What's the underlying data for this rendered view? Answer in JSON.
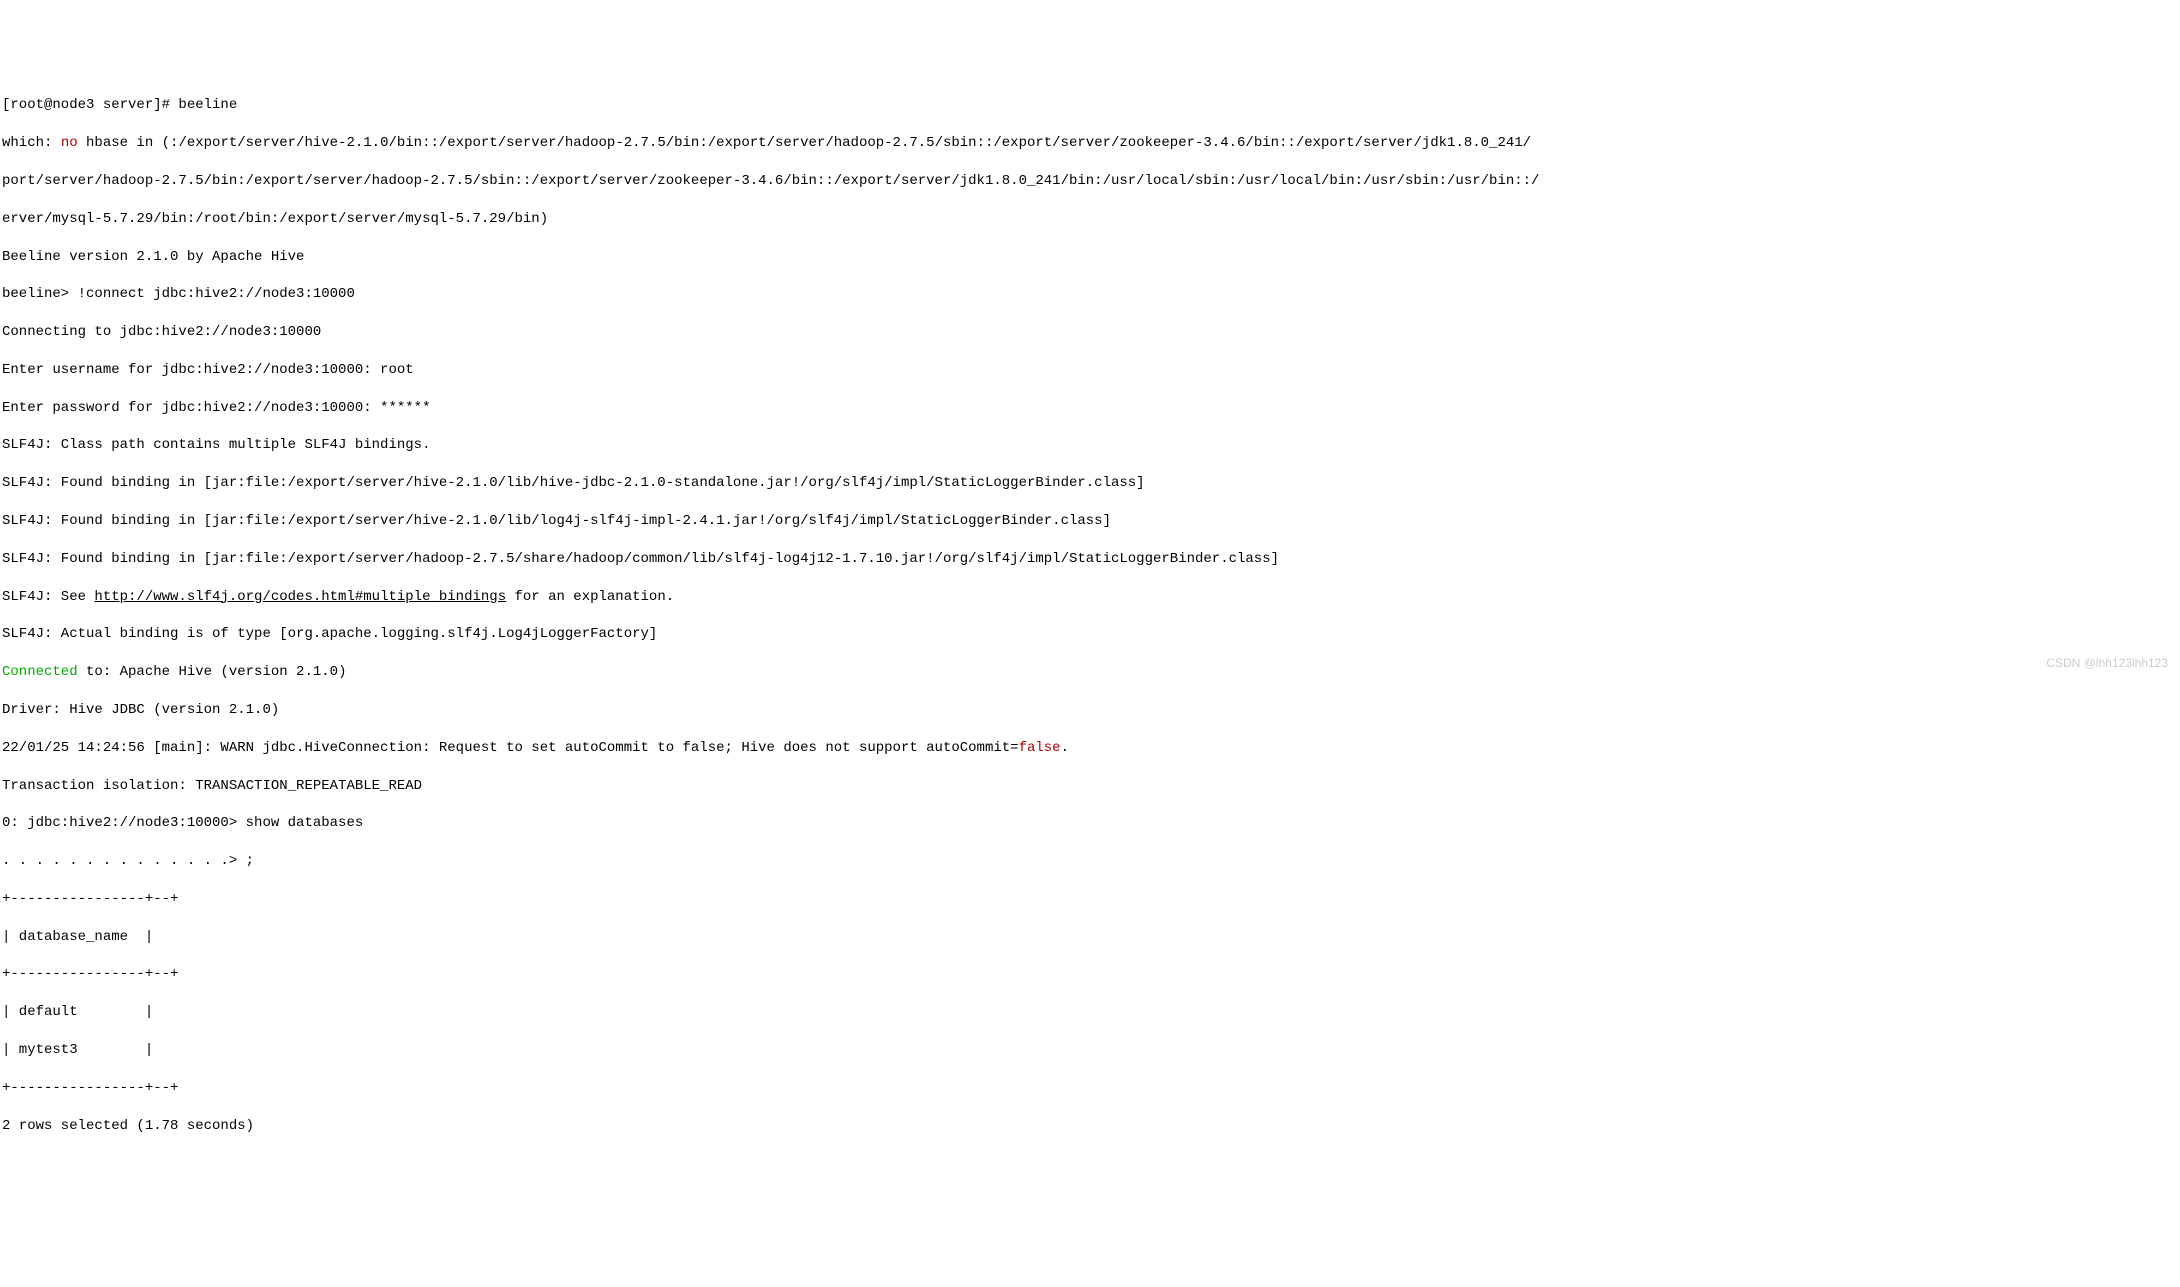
{
  "prompt1": "[root@node3 server]# beeline",
  "which_line_prefix": "which: ",
  "which_no": "no",
  "which_line_rest": " hbase in (:/export/server/hive-2.1.0/bin::/export/server/hadoop-2.7.5/bin:/export/server/hadoop-2.7.5/sbin::/export/server/zookeeper-3.4.6/bin::/export/server/jdk1.8.0_241/",
  "path_line2": "port/server/hadoop-2.7.5/bin:/export/server/hadoop-2.7.5/sbin::/export/server/zookeeper-3.4.6/bin::/export/server/jdk1.8.0_241/bin:/usr/local/sbin:/usr/local/bin:/usr/sbin:/usr/bin::/",
  "path_line3": "erver/mysql-5.7.29/bin:/root/bin:/export/server/mysql-5.7.29/bin)",
  "beeline_version": "Beeline version 2.1.0 by Apache Hive",
  "beeline_connect": "beeline> !connect jdbc:hive2://node3:10000",
  "connecting": "Connecting to jdbc:hive2://node3:10000",
  "enter_username": "Enter username for jdbc:hive2://node3:10000: root",
  "enter_password": "Enter password for jdbc:hive2://node3:10000: ******",
  "slf4j_1": "SLF4J: Class path contains multiple SLF4J bindings.",
  "slf4j_2": "SLF4J: Found binding in [jar:file:/export/server/hive-2.1.0/lib/hive-jdbc-2.1.0-standalone.jar!/org/slf4j/impl/StaticLoggerBinder.class]",
  "slf4j_3": "SLF4J: Found binding in [jar:file:/export/server/hive-2.1.0/lib/log4j-slf4j-impl-2.4.1.jar!/org/slf4j/impl/StaticLoggerBinder.class]",
  "slf4j_4": "SLF4J: Found binding in [jar:file:/export/server/hadoop-2.7.5/share/hadoop/common/lib/slf4j-log4j12-1.7.10.jar!/org/slf4j/impl/StaticLoggerBinder.class]",
  "slf4j_5_prefix": "SLF4J: See ",
  "slf4j_5_url": "http://www.slf4j.org/codes.html#multiple_bindings",
  "slf4j_5_suffix": " for an explanation.",
  "slf4j_6": "SLF4J: Actual binding is of type [org.apache.logging.slf4j.Log4jLoggerFactory]",
  "connected_word": "Connected",
  "connected_rest": " to: Apache Hive (version 2.1.0)",
  "driver_line": "Driver: Hive JDBC (version 2.1.0)",
  "warn_prefix": "22/01/25 14:24:56 [main]: WARN jdbc.HiveConnection: Request to set autoCommit to false; Hive does not support autoCommit=",
  "warn_false": "false",
  "warn_suffix": ".",
  "transaction": "Transaction isolation: TRANSACTION_REPEATABLE_READ",
  "sql_prompt": "0: jdbc:hive2://node3:10000> show databases",
  "sql_continuation": ". . . . . . . . . . . . . .> ;",
  "table_border": "+----------------+--+",
  "table_header": "| database_name  |",
  "table_row1": "| default        |",
  "table_row2": "| mytest3        |",
  "rows_selected": "2 rows selected (1.78 seconds)",
  "watermark": "CSDN @lhh123lhh123"
}
